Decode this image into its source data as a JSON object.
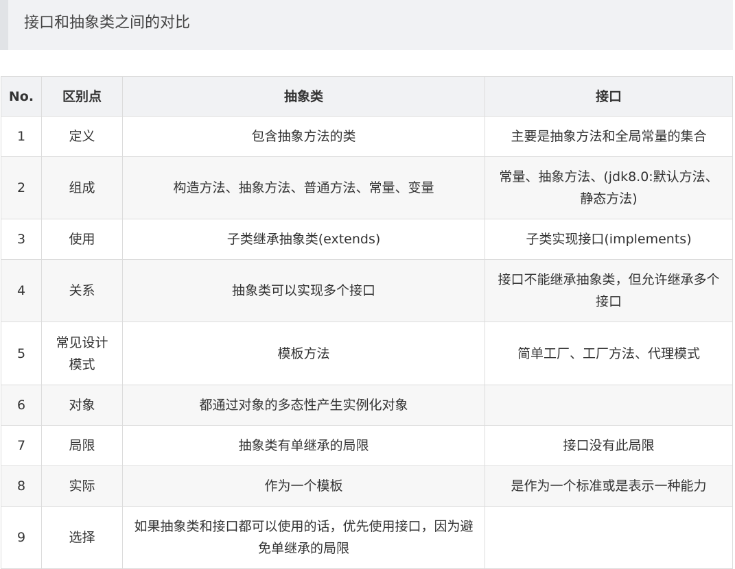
{
  "heading": "接口和抽象类之间的对比",
  "table": {
    "headers": [
      "No.",
      "区别点",
      "抽象类",
      "接口"
    ],
    "rows": [
      {
        "no": "1",
        "point": "定义",
        "abstract": "包含抽象方法的类",
        "interface": "主要是抽象方法和全局常量的集合"
      },
      {
        "no": "2",
        "point": "组成",
        "abstract": "构造方法、抽象方法、普通方法、常量、变量",
        "interface": "常量、抽象方法、(jdk8.0:默认方法、静态方法)"
      },
      {
        "no": "3",
        "point": "使用",
        "abstract": "子类继承抽象类(extends)",
        "interface": "子类实现接口(implements)"
      },
      {
        "no": "4",
        "point": "关系",
        "abstract": "抽象类可以实现多个接口",
        "interface": "接口不能继承抽象类，但允许继承多个接口"
      },
      {
        "no": "5",
        "point": "常见设计模式",
        "abstract": "模板方法",
        "interface": "简单工厂、工厂方法、代理模式"
      },
      {
        "no": "6",
        "point": "对象",
        "abstract": "都通过对象的多态性产生实例化对象",
        "interface": ""
      },
      {
        "no": "7",
        "point": "局限",
        "abstract": "抽象类有单继承的局限",
        "interface": "接口没有此局限"
      },
      {
        "no": "8",
        "point": "实际",
        "abstract": "作为一个模板",
        "interface": "是作为一个标准或是表示一种能力"
      },
      {
        "no": "9",
        "point": "选择",
        "abstract": "如果抽象类和接口都可以使用的话，优先使用接口，因为避免单继承的局限",
        "interface": ""
      }
    ]
  }
}
